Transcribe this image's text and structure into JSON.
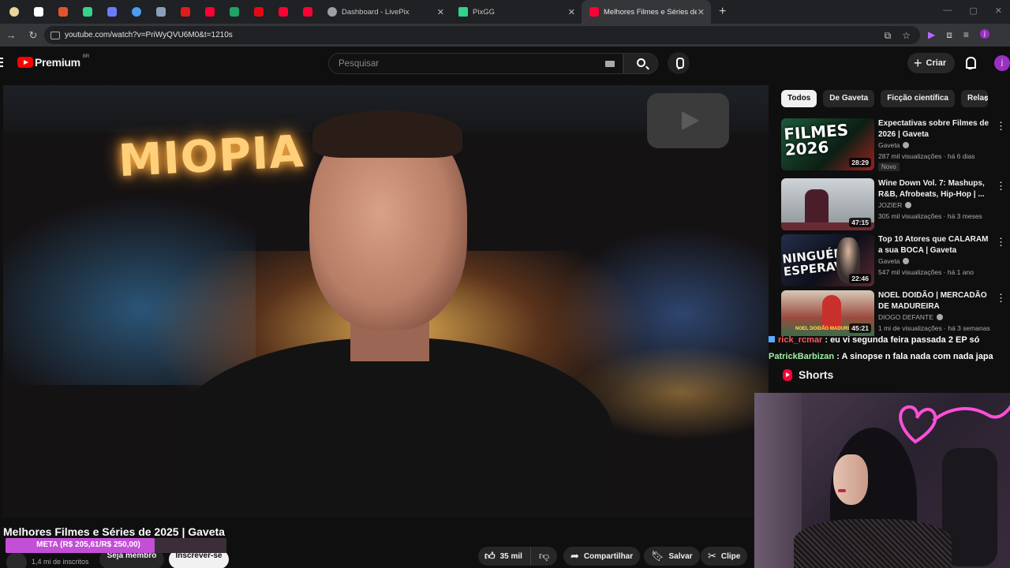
{
  "browser": {
    "pinned_tabs": [
      {
        "icon": "cloud-app-icon",
        "color": "#e9d69a"
      },
      {
        "icon": "diamond-app-icon",
        "color": "#ffffff"
      },
      {
        "icon": "fox-app-icon",
        "color": "#e2552b"
      },
      {
        "icon": "download-app-icon",
        "color": "#3ad28a"
      },
      {
        "icon": "shield-app-icon",
        "color": "#6b7bff"
      },
      {
        "icon": "chrome-app-icon",
        "color": "#4a9cf0"
      },
      {
        "icon": "folder-app-icon",
        "color": "#8aa0b8"
      },
      {
        "icon": "flag-app-icon",
        "color": "#e21b1b"
      },
      {
        "icon": "youtube-app-icon",
        "color": "#ff0033"
      },
      {
        "icon": "drive-app-icon",
        "color": "#1fa463"
      },
      {
        "icon": "netflix-app-icon",
        "color": "#e50914"
      },
      {
        "icon": "youtube-app-icon",
        "color": "#ff0033"
      },
      {
        "icon": "youtube-app-icon",
        "color": "#ff0033"
      }
    ],
    "tabs": [
      {
        "label": "Dashboard - LivePix",
        "icon": "globe-icon",
        "color": "#9aa0a6",
        "close": "✕"
      },
      {
        "label": "PixGG",
        "icon": "pixgg-icon",
        "color": "#2fd48c",
        "close": "✕"
      },
      {
        "label": "Melhores Filmes e Séries de 202",
        "icon": "youtube-tab-icon",
        "color": "#ff0033",
        "close": "✕"
      }
    ],
    "new_tab": "+",
    "window_controls": [
      "—",
      "▢",
      "✕"
    ],
    "url": "youtube.com/watch?v=PriWyQVU6M0&t=1210s"
  },
  "youtube": {
    "brand": "Premium",
    "country": "BR",
    "search_placeholder": "Pesquisar",
    "create_label": "Criar",
    "avatar_letter": "j"
  },
  "video": {
    "neon_sign": "MIOPIA",
    "title": "Melhores Filmes e Séries de 2025 | Gaveta",
    "subscribers": "1,4 mi de inscritos",
    "member_label": "Seja membro",
    "subscribe_label": "Inscrever-se",
    "likes": "35 mil",
    "share_label": "Compartilhar",
    "save_label": "Salvar",
    "clip_label": "Clipe"
  },
  "goal": {
    "text": "META (R$ 205,61/R$ 250,00)",
    "current": 205.61,
    "target": 250.0
  },
  "chips": [
    "Todos",
    "De Gaveta",
    "Ficção científica",
    "Relac"
  ],
  "recommended": [
    {
      "title": "Expectativas sobre Filmes de 2026 | Gaveta",
      "channel": "Gaveta",
      "views": "287 mil visualizações · há 6 dias",
      "duration": "28:29",
      "badge": "Novo",
      "thumb_text": "FILMES 2026"
    },
    {
      "title": "Wine Down Vol. 7: Mashups, R&B, Afrobeats, Hip-Hop | ...",
      "channel": "JOZIER",
      "views": "305 mil visualizações · há 3 meses",
      "duration": "47:15",
      "badge": "",
      "thumb_text": ""
    },
    {
      "title": "Top 10 Atores que CALARAM a sua BOCA | Gaveta",
      "channel": "Gaveta",
      "views": "547 mil visualizações · há 1 ano",
      "duration": "22:46",
      "badge": "",
      "thumb_text": "NINGUÉM ESPERAVA"
    },
    {
      "title": "NOEL DOIDÃO | MERCADÃO DE MADUREIRA",
      "channel": "DIOGO DEFANTE",
      "views": "1 mi de visualizações · há 3 semanas",
      "duration": "45:21",
      "badge": "",
      "thumb_text": "NOEL DOIDÃO MADUREIRA"
    }
  ],
  "chat": [
    {
      "user": "rick_rcmar",
      "message": "eu vi segunda feira passada 2 EP só"
    },
    {
      "user": "PatrickBarbizan",
      "message": "A sinopse n fala nada com nada japa"
    }
  ],
  "shorts_label": "Shorts"
}
